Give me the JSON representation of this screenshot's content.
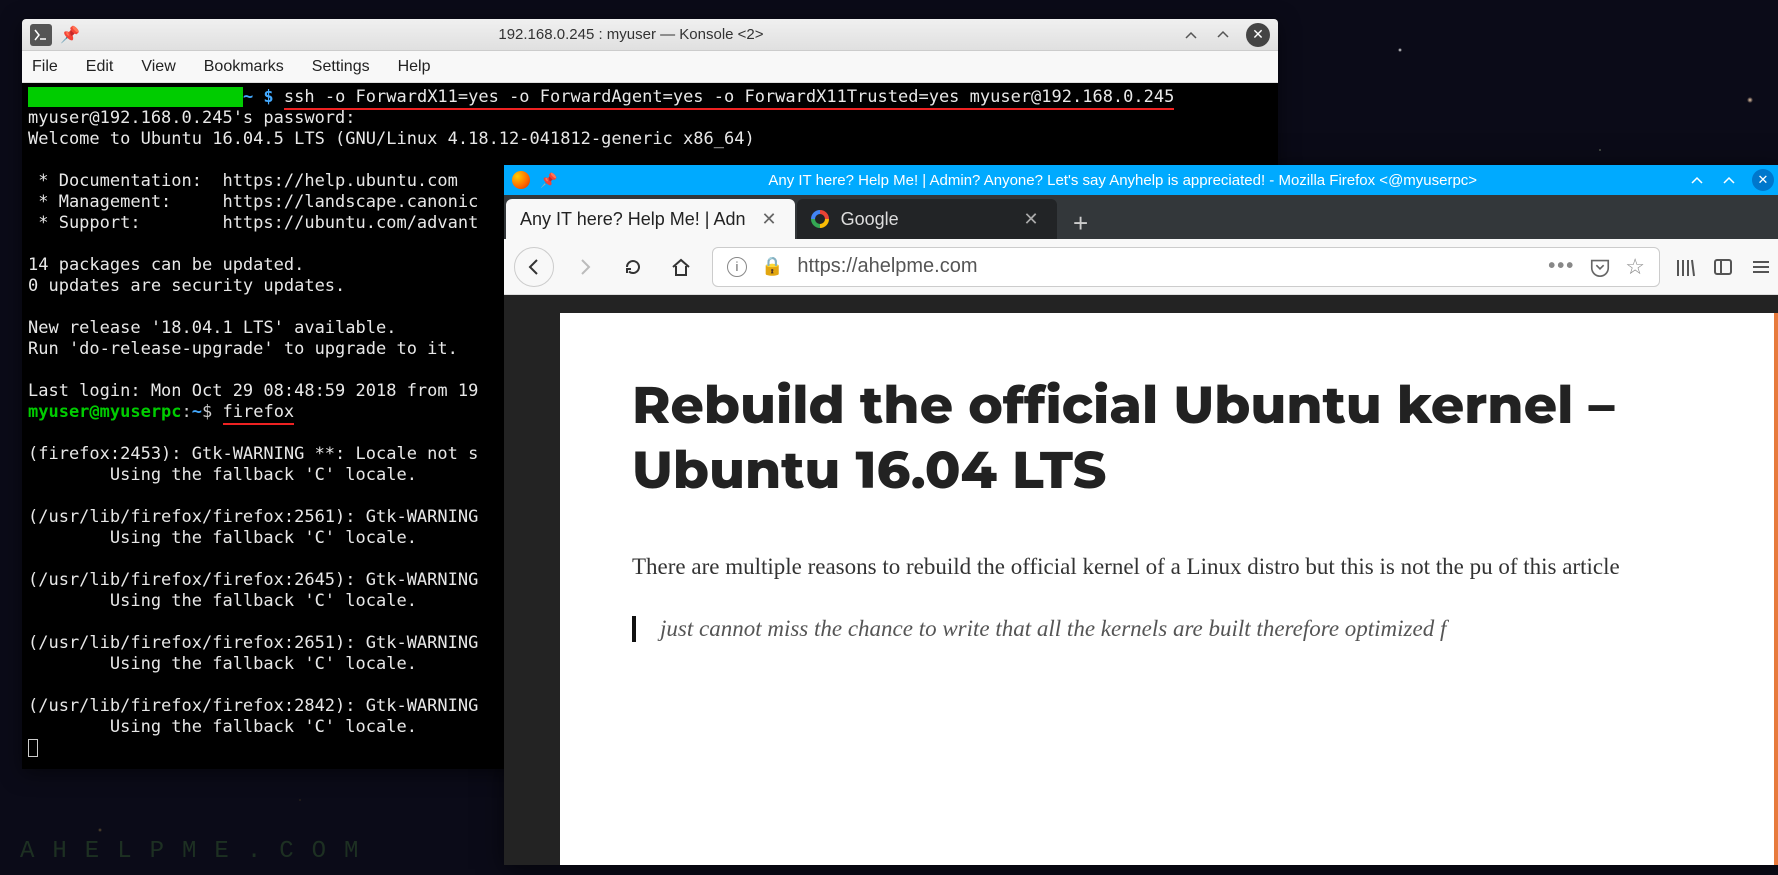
{
  "desktop": {
    "watermark": "AHELPME.COM"
  },
  "konsole": {
    "title": "192.168.0.245 : myuser — Konsole <2>",
    "menubar": [
      "File",
      "Edit",
      "View",
      "Bookmarks",
      "Settings",
      "Help"
    ],
    "prompt1_cmd": "ssh -o ForwardX11=yes -o ForwardAgent=yes -o ForwardX11Trusted=yes myuser@192.168.0.245",
    "line_pw": "myuser@192.168.0.245's password:",
    "line_welcome": "Welcome to Ubuntu 16.04.5 LTS (GNU/Linux 4.18.12-041812-generic x86_64)",
    "bullet_doc": " * Documentation:  https://help.ubuntu.com",
    "bullet_mgmt": " * Management:     https://landscape.canonic",
    "bullet_sup": " * Support:        https://ubuntu.com/advant",
    "pkg1": "14 packages can be updated.",
    "pkg2": "0 updates are security updates.",
    "rel1": "New release '18.04.1 LTS' available.",
    "rel2": "Run 'do-release-upgrade' to upgrade to it.",
    "lastlogin": "Last login: Mon Oct 29 08:48:59 2018 from 19",
    "prompt2_user": "myuser@myuserpc",
    "prompt2_path": "~",
    "prompt2_cmd": "firefox",
    "warn1a": "(firefox:2453): Gtk-WARNING **: Locale not s",
    "warn_fb": "        Using the fallback 'C' locale.",
    "warn2a": "(/usr/lib/firefox/firefox:2561): Gtk-WARNING",
    "warn3a": "(/usr/lib/firefox/firefox:2645): Gtk-WARNING",
    "warn4a": "(/usr/lib/firefox/firefox:2651): Gtk-WARNING",
    "warn5a": "(/usr/lib/firefox/firefox:2842): Gtk-WARNING"
  },
  "firefox": {
    "title": "Any IT here? Help Me! | Admin? Anyone? Let's say Anyhelp is appreciated! - Mozilla Firefox <@myuserpc>",
    "tabs": [
      {
        "label": "Any IT here? Help Me! | Adn",
        "active": true
      },
      {
        "label": "Google",
        "active": false
      }
    ],
    "url": "https://ahelpme.com",
    "page": {
      "heading": "Rebuild the official Ubuntu ker­nel – Ubuntu 16.04 LTS",
      "para": "There are multiple reasons to rebuild the official kernel of a Linux distro but this is not the pu of this article",
      "quote": "just cannot miss the chance to write that all the kernels are built therefore optimized f"
    }
  }
}
